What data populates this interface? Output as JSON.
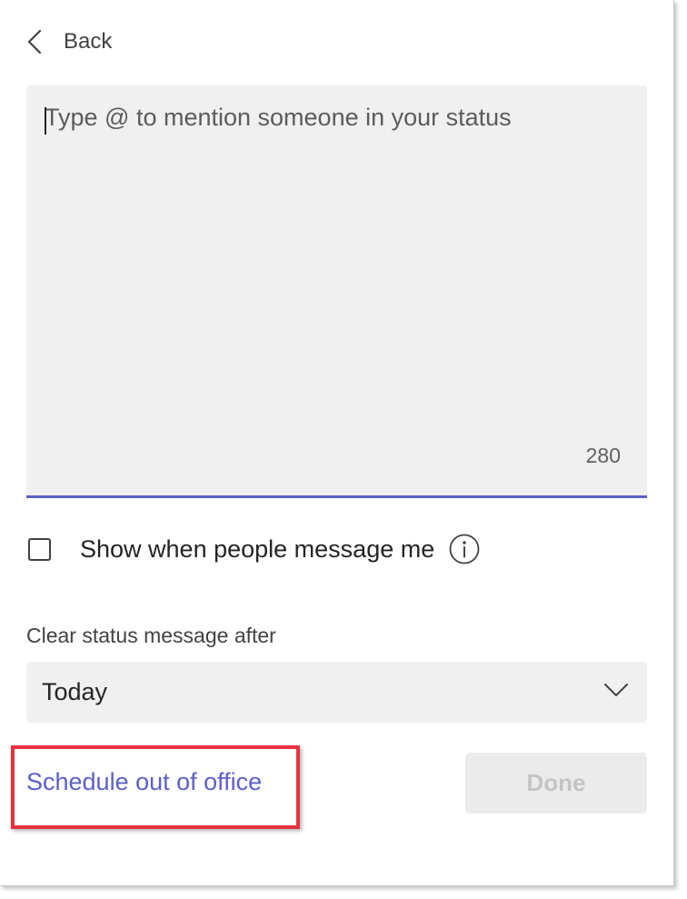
{
  "nav": {
    "back_label": "Back"
  },
  "status": {
    "placeholder": "Type @ to mention someone in your status",
    "value": "",
    "char_remaining": "280"
  },
  "show_when_messaged": {
    "label": "Show when people message me",
    "checked": false
  },
  "clear_after": {
    "label": "Clear status message after",
    "selected": "Today"
  },
  "actions": {
    "schedule_ooo_label": "Schedule out of office",
    "done_label": "Done",
    "done_enabled": false
  },
  "colors": {
    "accent": "#5b5fc7",
    "highlight_border": "#e8333c",
    "field_background": "#f0f0f0"
  },
  "icons": {
    "back": "chevron-left-icon",
    "info": "info-icon",
    "dropdown": "chevron-down-icon"
  }
}
